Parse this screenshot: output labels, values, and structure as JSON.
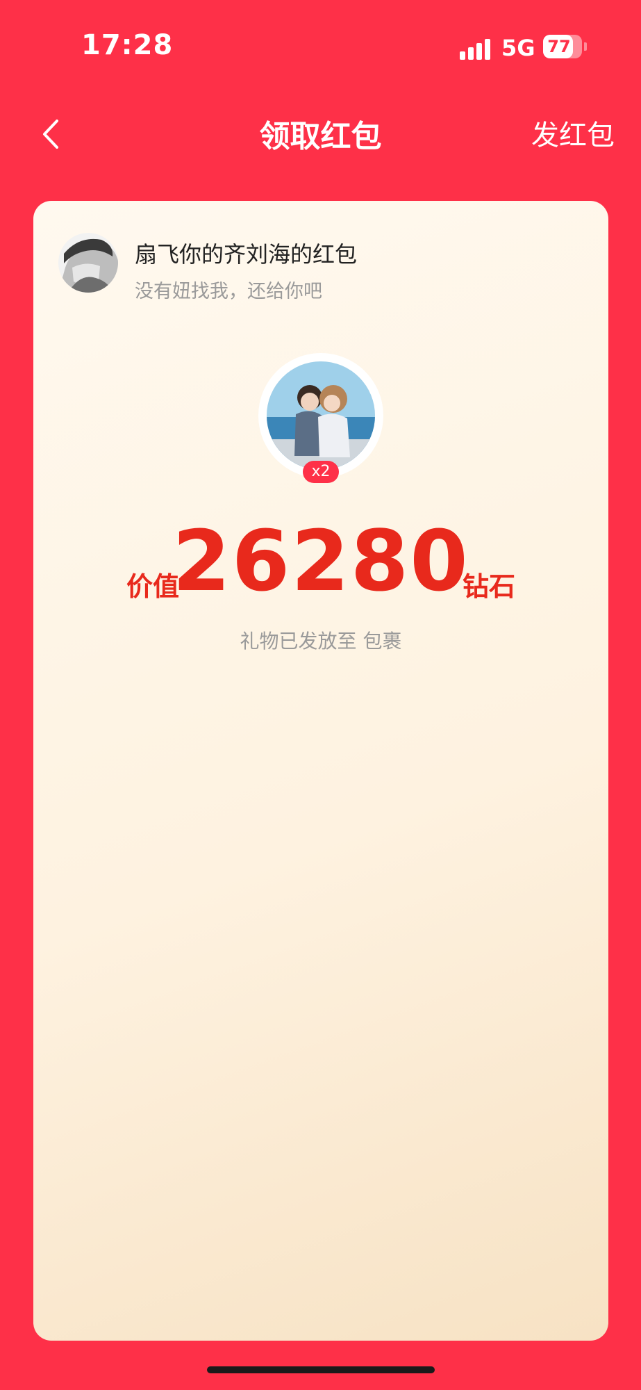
{
  "status_bar": {
    "time": "17:28",
    "network": "5G",
    "battery": "77",
    "battery_level": 0.77
  },
  "nav": {
    "title": "领取红包",
    "send_label": "发红包",
    "back_icon": "chevron-left-icon"
  },
  "card": {
    "sender_name": "扇飞你的齐刘海的红包",
    "sender_message": "没有妞找我，还给你吧",
    "gift_count": "x2",
    "value_prefix": "价值",
    "value_amount": "26280",
    "value_unit": "钻石",
    "gift_status": "礼物已发放至 包裹"
  },
  "colors": {
    "background": "#FE3048",
    "accent_text": "#E8291C",
    "card_start": "#FFF9EF",
    "card_end": "#F7E2C4"
  }
}
